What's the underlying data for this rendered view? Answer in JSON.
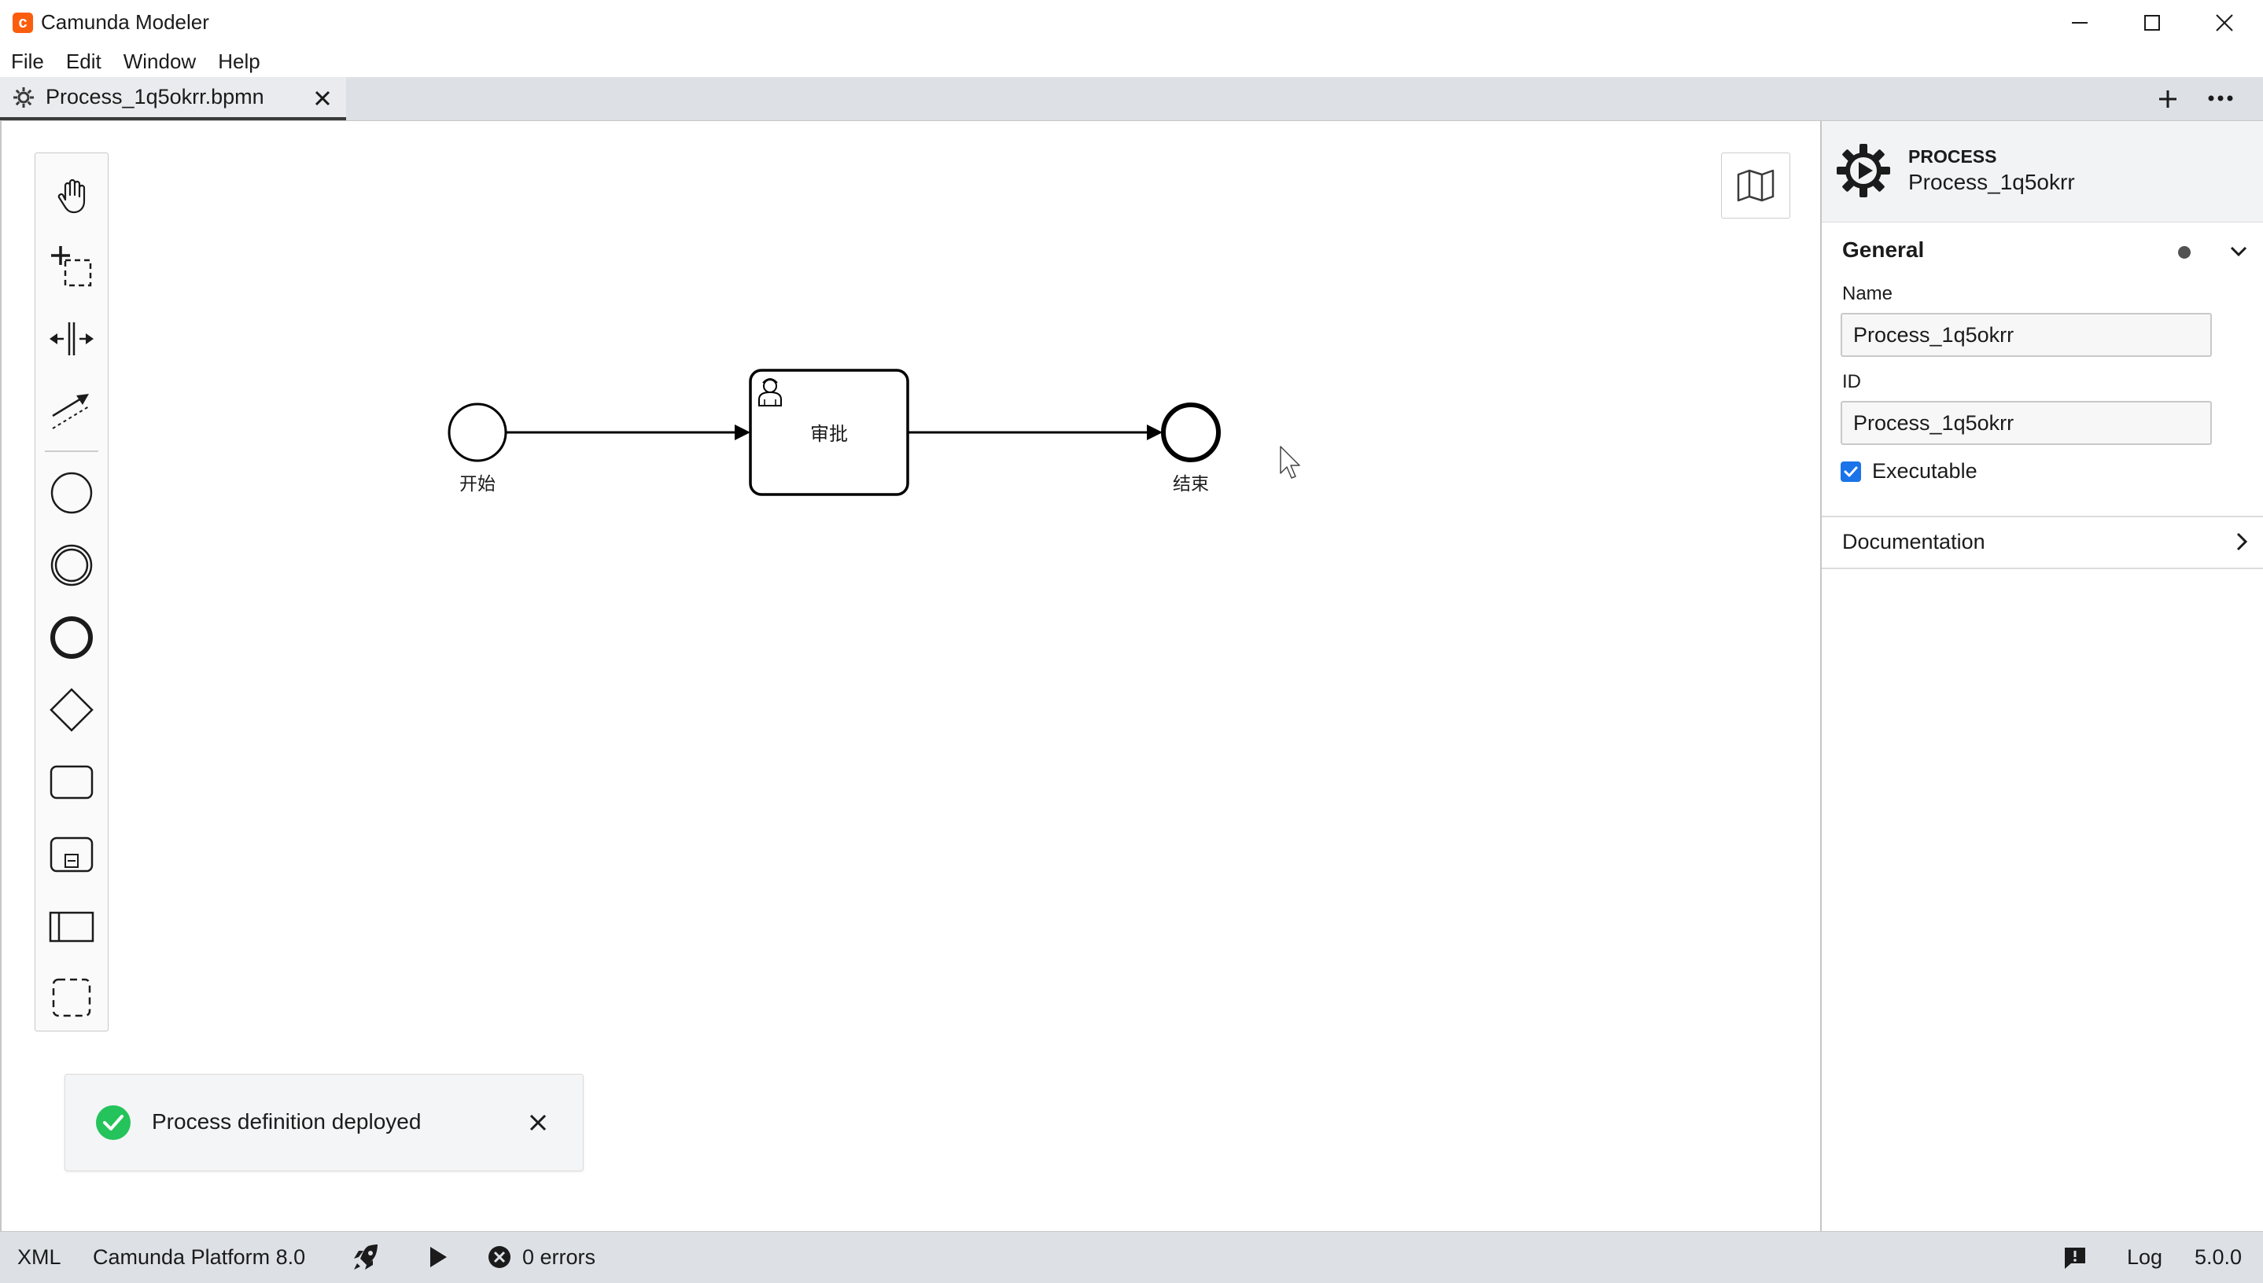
{
  "window": {
    "title": "Camunda Modeler",
    "app_icon": "camunda-logo",
    "controls": [
      "minimize-icon",
      "maximize-icon",
      "close-icon"
    ]
  },
  "menu": [
    "File",
    "Edit",
    "Window",
    "Help"
  ],
  "tabs": [
    {
      "label": "Process_1q5okrr.bpmn",
      "icon": "gear-icon",
      "active": true
    }
  ],
  "tabbar_actions": [
    "plus-icon",
    "more-icon"
  ],
  "palette": [
    "hand-tool-icon",
    "lasso-tool-icon",
    "space-tool-icon",
    "connect-tool-icon",
    "start-event-icon",
    "intermediate-event-icon",
    "end-event-icon",
    "gateway-icon",
    "task-icon",
    "subprocess-icon",
    "pool-icon",
    "group-icon"
  ],
  "diagram": {
    "start_event": {
      "label": "开始"
    },
    "user_task": {
      "label": "审批",
      "icon": "user-icon"
    },
    "end_event": {
      "label": "结束"
    }
  },
  "toast": {
    "message": "Process definition deployed",
    "status_color": "#24c35b"
  },
  "properties": {
    "element_type": "PROCESS",
    "element_name": "Process_1q5okrr",
    "general": {
      "title": "General",
      "name_label": "Name",
      "name_value": "Process_1q5okrr",
      "id_label": "ID",
      "id_value": "Process_1q5okrr",
      "executable_label": "Executable",
      "executable_checked": true
    },
    "documentation": {
      "title": "Documentation"
    }
  },
  "statusbar": {
    "xml": "XML",
    "platform": "Camunda Platform 8.0",
    "errors": "0 errors",
    "log": "Log",
    "version": "5.0.0"
  },
  "colors": {
    "accent": "#1a73e8",
    "brand": "#fc5d0d",
    "success": "#24c35b"
  }
}
